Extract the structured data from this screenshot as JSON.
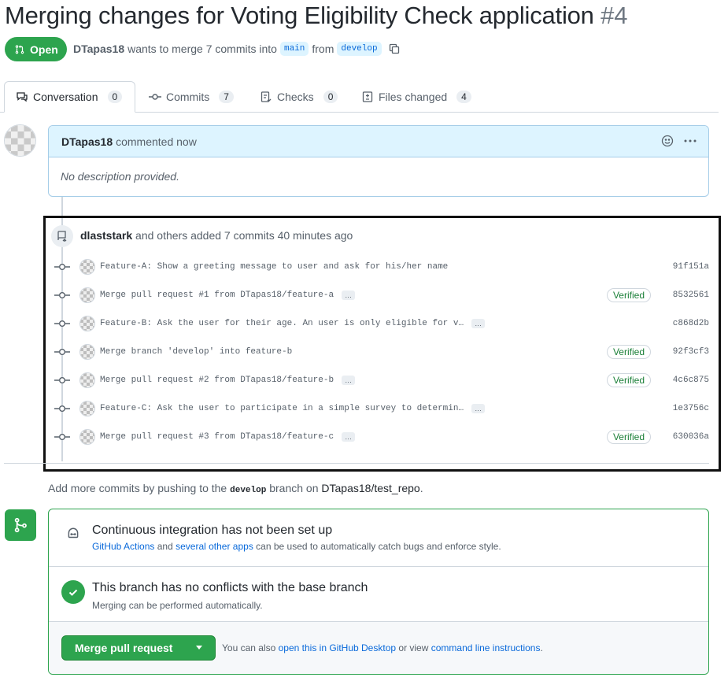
{
  "pr": {
    "title": "Merging changes for Voting Eligibility Check application",
    "number": "#4",
    "status": "Open",
    "author": "DTapas18",
    "wants_text": "wants to merge 7 commits into",
    "base_branch": "main",
    "from_text": "from",
    "head_branch": "develop"
  },
  "tabs": [
    {
      "label": "Conversation",
      "count": "0",
      "icon": "conversation-icon"
    },
    {
      "label": "Commits",
      "count": "7",
      "icon": "commit-icon"
    },
    {
      "label": "Checks",
      "count": "0",
      "icon": "checklist-icon"
    },
    {
      "label": "Files changed",
      "count": "4",
      "icon": "diff-icon"
    }
  ],
  "comment": {
    "author": "DTapas18",
    "action": "commented now",
    "body": "No description provided."
  },
  "push": {
    "author": "dlaststark",
    "text": "and others added 7 commits 40 minutes ago"
  },
  "commits": [
    {
      "message": "Feature-A: Show a greeting message to user and ask for his/her name",
      "sha": "91f151a",
      "verified": "",
      "ellipsis": false
    },
    {
      "message": "Merge pull request #1 from DTapas18/feature-a",
      "sha": "8532561",
      "verified": "Verified",
      "ellipsis": true
    },
    {
      "message": "Feature-B: Ask the user for their age. An user is only eligible for v…",
      "sha": "c868d2b",
      "verified": "",
      "ellipsis": true
    },
    {
      "message": "Merge branch 'develop' into feature-b",
      "sha": "92f3cf3",
      "verified": "Verified",
      "ellipsis": false
    },
    {
      "message": "Merge pull request #2 from DTapas18/feature-b",
      "sha": "4c6c875",
      "verified": "Verified",
      "ellipsis": true
    },
    {
      "message": "Feature-C: Ask the user to participate in a simple survey to determin…",
      "sha": "1e3756c",
      "verified": "",
      "ellipsis": true
    },
    {
      "message": "Merge pull request #3 from DTapas18/feature-c",
      "sha": "630036a",
      "verified": "Verified",
      "ellipsis": true
    }
  ],
  "add_more": {
    "prefix": "Add more commits by pushing to the",
    "branch": "develop",
    "middle": "branch on",
    "repo": "DTapas18/test_repo",
    "suffix": "."
  },
  "ci": {
    "title": "Continuous integration has not been set up",
    "link1": "GitHub Actions",
    "and": "and",
    "link2": "several other apps",
    "rest": "can be used to automatically catch bugs and enforce style."
  },
  "conflicts": {
    "title": "This branch has no conflicts with the base branch",
    "subtitle": "Merging can be performed automatically."
  },
  "merge": {
    "button_label": "Merge pull request",
    "also_text": "You can also",
    "link1": "open this in GitHub Desktop",
    "or_text": "or view",
    "link2": "command line instructions",
    "end": "."
  },
  "colors": {
    "green": "#2da44e",
    "blue_link": "#0969da",
    "comment_header": "#ddf4ff"
  }
}
